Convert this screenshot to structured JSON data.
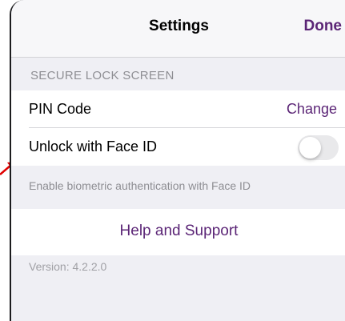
{
  "navbar": {
    "title": "Settings",
    "done_label": "Done"
  },
  "section": {
    "header": "SECURE LOCK SCREEN"
  },
  "rows": [
    {
      "label": "PIN Code",
      "value": "Change"
    },
    {
      "label": "Unlock with Face ID",
      "toggle": false
    }
  ],
  "footer": "Enable biometric authentication with Face ID",
  "help": {
    "label": "Help and Support"
  },
  "version": "Version: 4.2.2.0",
  "colors": {
    "accent": "#5b2576",
    "background": "#efeff4",
    "annotation": "#e00000"
  }
}
